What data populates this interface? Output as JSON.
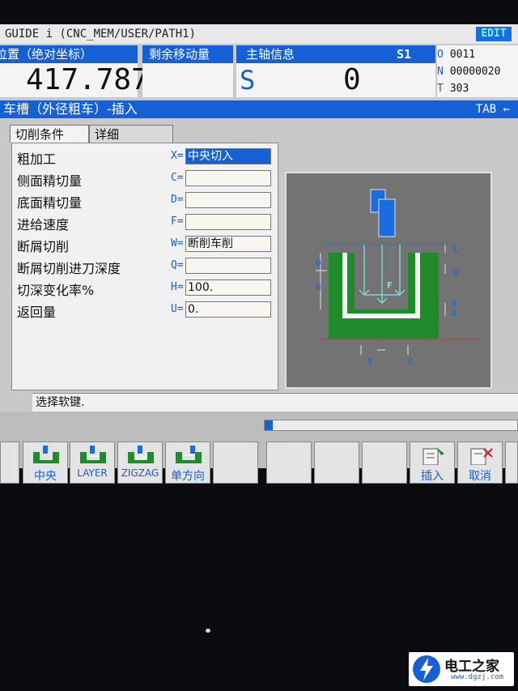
{
  "header": {
    "title": "GUIDE i (CNC_MEM/USER/PATH1)",
    "mode": "EDIT"
  },
  "status": {
    "position_label": "位置（绝对坐标）",
    "position_value": "417.787",
    "remaining_label": "剩余移动量",
    "spindle_label": "主轴信息",
    "spindle_channel": "S1",
    "s_letter": "S",
    "spindle_value": "0",
    "o_key": "O",
    "o_value": "0011",
    "n_key": "N",
    "n_value": "00000020",
    "t_key": "T",
    "t_value": "303"
  },
  "cycle": {
    "title": "车槽（外径粗车）-插入",
    "tab_hint": "TAB ←"
  },
  "tabs": [
    {
      "label": "切削条件"
    },
    {
      "label": "详细"
    }
  ],
  "form": {
    "rows": [
      {
        "label": "粗加工",
        "key": "X=",
        "value": "中央切入"
      },
      {
        "label": "侧面精切量",
        "key": "C=",
        "value": ""
      },
      {
        "label": "底面精切量",
        "key": "D=",
        "value": ""
      },
      {
        "label": "进给速度",
        "key": "F=",
        "value": ""
      },
      {
        "label": "断屑切削",
        "key": "W=",
        "value": "断削车削"
      },
      {
        "label": "断屑切削进刀深度",
        "key": "Q=",
        "value": ""
      },
      {
        "label": "切深变化率%",
        "key": "H=",
        "value": "100."
      },
      {
        "label": "返回量",
        "key": "U=",
        "value": "0."
      }
    ]
  },
  "diagram": {
    "labels": {
      "L": "L",
      "U": "U",
      "Q": "Q",
      "H": "H",
      "F": "F",
      "V": "V",
      "D": "D",
      "S": "S",
      "C": "C"
    }
  },
  "message": "选择软键.",
  "softkeys": [
    {
      "label": "中央"
    },
    {
      "label": "LAYER"
    },
    {
      "label": "ZIGZAG"
    },
    {
      "label": "单方向"
    },
    {
      "label": "插入"
    },
    {
      "label": "取消"
    }
  ],
  "watermark": {
    "name": "电工之家",
    "url": "www.dgzj.com"
  },
  "colors": {
    "accent": "#1560d4",
    "panel": "#c9c9c9",
    "workpiece": "#1f8b2a"
  }
}
